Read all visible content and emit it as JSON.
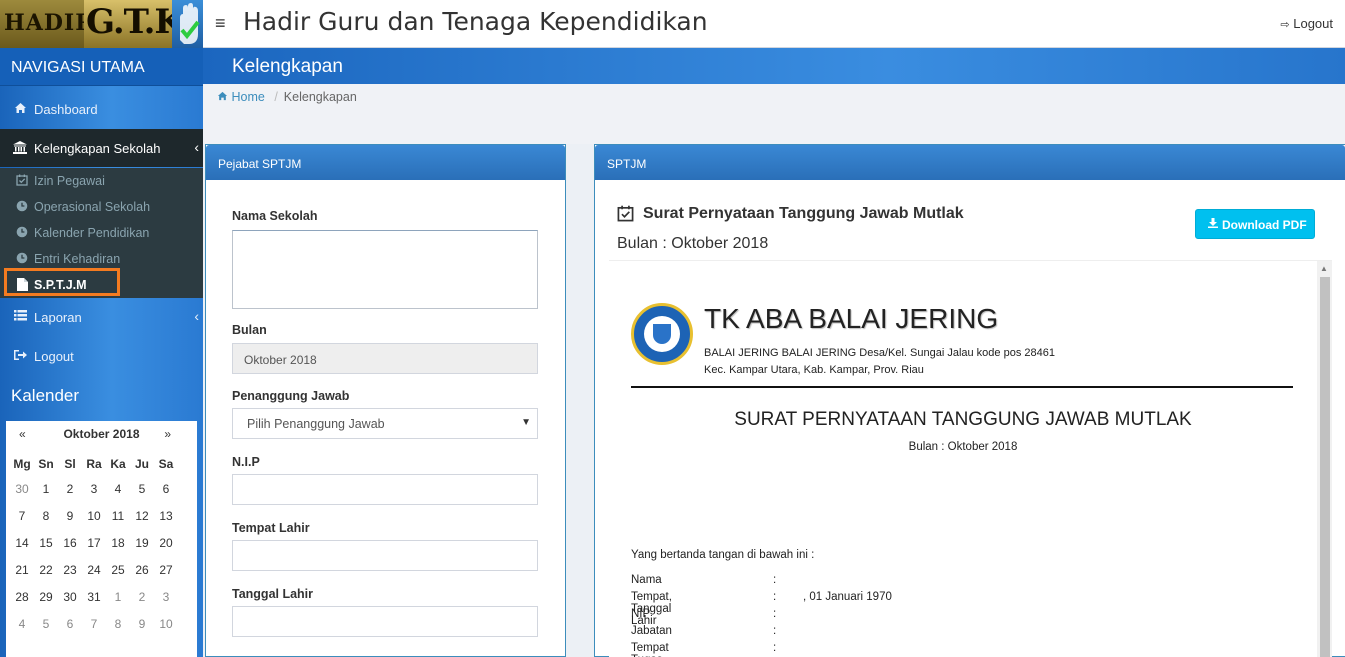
{
  "header": {
    "logo_text_small": "HADIR",
    "logo_text_big": "G.T.K",
    "title": "Hadir Guru dan Tenaga Kependidikan",
    "menu_toggle": "≡",
    "logout_label": "Logout"
  },
  "sidebar": {
    "nav_title": "NAVIGASI UTAMA",
    "items": [
      {
        "label": "Dashboard",
        "icon": "home-icon"
      },
      {
        "label": "Kelengkapan Sekolah",
        "icon": "bank-icon"
      },
      {
        "label": "Laporan",
        "icon": "list-icon"
      },
      {
        "label": "Logout",
        "icon": "sign-out-icon"
      }
    ],
    "submenu": [
      {
        "label": "Izin Pegawai",
        "icon": "calendar-check-icon"
      },
      {
        "label": "Operasional Sekolah",
        "icon": "clock-icon"
      },
      {
        "label": "Kalender Pendidikan",
        "icon": "clock-icon"
      },
      {
        "label": "Entri Kehadiran",
        "icon": "clock-icon"
      },
      {
        "label": "S.P.T.J.M",
        "icon": "file-icon"
      }
    ]
  },
  "calendar": {
    "title": "Kalender",
    "prev": "«",
    "next": "»",
    "month": "Oktober 2018",
    "days": [
      "Mg",
      "Sn",
      "Sl",
      "Ra",
      "Ka",
      "Ju",
      "Sa"
    ],
    "weeks": [
      [
        "30",
        "1",
        "2",
        "3",
        "4",
        "5",
        "6"
      ],
      [
        "7",
        "8",
        "9",
        "10",
        "11",
        "12",
        "13"
      ],
      [
        "14",
        "15",
        "16",
        "17",
        "18",
        "19",
        "20"
      ],
      [
        "21",
        "22",
        "23",
        "24",
        "25",
        "26",
        "27"
      ],
      [
        "28",
        "29",
        "30",
        "31",
        "1",
        "2",
        "3"
      ],
      [
        "4",
        "5",
        "6",
        "7",
        "8",
        "9",
        "10"
      ]
    ]
  },
  "content": {
    "page_title": "Kelengkapan",
    "breadcrumb": {
      "home": "Home",
      "current": "Kelengkapan"
    }
  },
  "left_box": {
    "title": "Pejabat SPTJM",
    "fields": {
      "nama_sekolah": "Nama Sekolah",
      "bulan": "Bulan",
      "bulan_value": "Oktober 2018",
      "penanggung_jawab": "Penanggung Jawab",
      "penanggung_jawab_value": "Pilih Penanggung Jawab",
      "nip": "N.I.P",
      "tempat_lahir": "Tempat Lahir",
      "tanggal_lahir": "Tanggal Lahir"
    }
  },
  "right_box": {
    "title": "SPTJM",
    "doc_title": "Surat Pernyataan Tanggung Jawab Mutlak",
    "doc_month": "Bulan : Oktober 2018",
    "download_label": "Download PDF"
  },
  "letter": {
    "school_name": "TK ABA BALAI JERING",
    "address1": "BALAI JERING BALAI JERING Desa/Kel. Sungai Jalau kode pos 28461",
    "address2": "Kec. Kampar Utara, Kab. Kampar, Prov. Riau",
    "title": "SURAT PERNYATAAN TANGGUNG JAWAB MUTLAK",
    "month": "Bulan : Oktober 2018",
    "intro": "Yang bertanda tangan di bawah ini :",
    "fields": [
      {
        "key": "Nama",
        "colon": ":",
        "value": ""
      },
      {
        "key": "Tempat, Tanggal Lahir",
        "colon": ":",
        "value": ", 01 Januari 1970"
      },
      {
        "key": "NIP",
        "colon": ":",
        "value": ""
      },
      {
        "key": "Jabatan",
        "colon": ":",
        "value": ""
      },
      {
        "key": "Tempat Tugas",
        "colon": ":",
        "value": ""
      }
    ]
  },
  "colors": {
    "brand_blue": "#3c8dbc",
    "sidebar_dark": "#1e282c",
    "highlight_orange": "#f47b20",
    "button_cyan": "#00c0ef"
  }
}
